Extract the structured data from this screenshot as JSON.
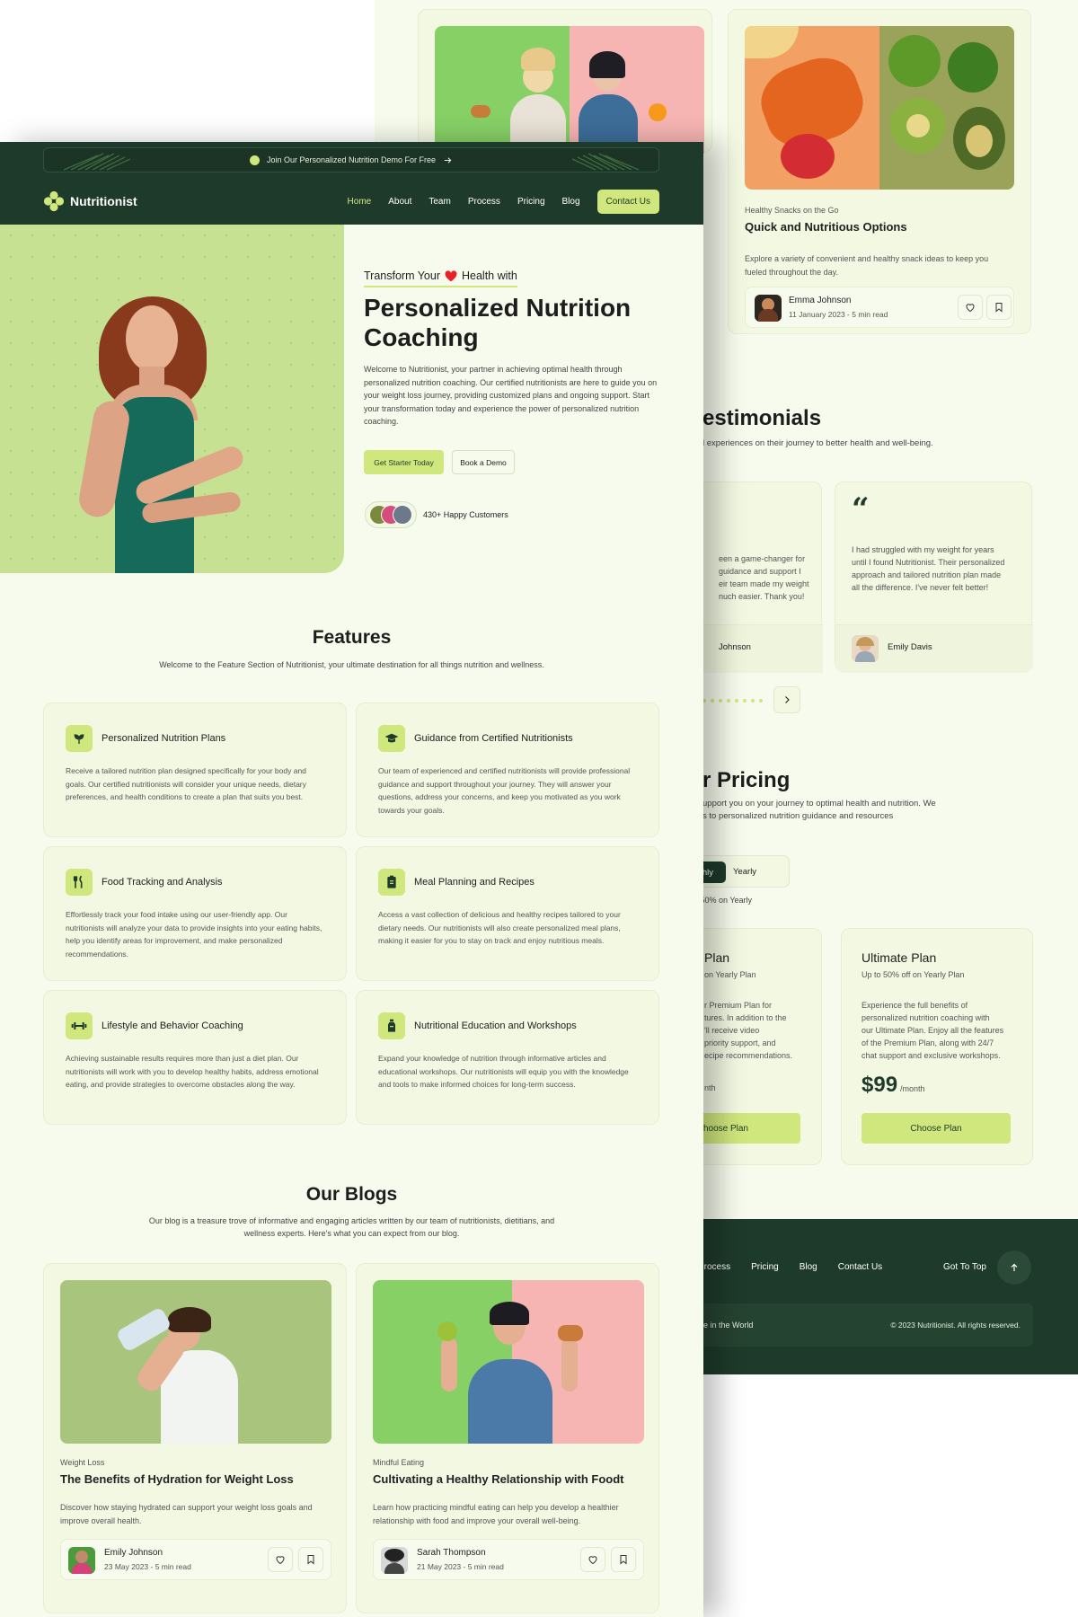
{
  "colors": {
    "dark": "#1e3a2b",
    "accent": "#cfe77c",
    "bg": "#f7fbed",
    "heart": "#e8202a"
  },
  "back": {
    "blog": {
      "category": "Healthy Snacks on the Go",
      "title": "Quick and Nutritious Options",
      "desc": "Explore a variety of convenient and healthy snack ideas to keep you fueled throughout the day.",
      "author": "Emma Johnson",
      "meta": "11 January 2023 - 5 min read"
    },
    "testimonials": {
      "title": "estimonials",
      "sub": "l experiences on their journey to better health and well-being.",
      "t1_lines": [
        "een a game-changer for",
        "guidance and support I",
        "eir team made my weight",
        "nuch easier. Thank you!"
      ],
      "t1_name": "Johnson",
      "quote_mark": "“",
      "t2_lines": [
        "I had struggled with my weight for years",
        "until I found Nutritionist. Their personalized",
        "approach and tailored nutrition plan made",
        "all the difference. I've never felt better!"
      ],
      "t2_name": "Emily Davis"
    },
    "pricing": {
      "title": "r Pricing",
      "sub_lines": [
        "upport you on your journey to optimal health and nutrition. We",
        "s to personalized nutrition guidance and resources"
      ],
      "toggle_active": "hly",
      "toggle_other": "Yearly",
      "save": "e 50% on Yearly",
      "plan1_name": "Plan",
      "plan1_sub": "on Yearly Plan",
      "plan1_lines": [
        "r Premium Plan for",
        "tures. In addition to the",
        "'ll receive video",
        "priority support, and",
        "ecipe recommendations."
      ],
      "plan1_price_tail": "nth",
      "plan1_btn": "hoose Plan",
      "plan2_name": "Ultimate Plan",
      "plan2_sub": "Up to 50% off on Yearly Plan",
      "plan2_lines": [
        "Experience the full benefits of",
        "personalized nutrition coaching with",
        "our Ultimate Plan. Enjoy all the features",
        "of the Premium Plan, along with 24/7",
        "chat support and exclusive workshops."
      ],
      "plan2_price": "$99",
      "plan2_per": "/month",
      "plan2_btn": "Choose Plan"
    },
    "footer": {
      "links": [
        "Process",
        "Pricing",
        "Blog",
        "Contact Us"
      ],
      "go_top": "Got To Top",
      "left_text": "re in the World",
      "copyright": "© 2023 Nutritionist. All rights reserved."
    }
  },
  "front": {
    "banner": "Join Our Personalized Nutrition Demo For Free",
    "brand": "Nutritionist",
    "nav": [
      "Home",
      "About",
      "Team",
      "Process",
      "Pricing",
      "Blog"
    ],
    "contact": "Contact Us",
    "hero": {
      "tag_pre": "Transform Your",
      "tag_post": "Health with",
      "title_l1": "Personalized Nutrition",
      "title_l2": "Coaching",
      "desc": "Welcome to Nutritionist, your partner in achieving optimal health through personalized nutrition coaching. Our certified nutritionists are here to guide you on your weight loss journey, providing customized plans and ongoing support. Start your transformation today and experience the power of personalized nutrition coaching.",
      "btn_primary": "Get Starter Today",
      "btn_secondary": "Book a Demo",
      "customers": "430+ Happy Customers"
    },
    "features": {
      "title": "Features",
      "sub": "Welcome to the Feature Section of Nutritionist, your ultimate destination for all things nutrition and wellness.",
      "items": [
        {
          "icon": "sprout-icon",
          "title": "Personalized Nutrition Plans",
          "desc": "Receive a tailored nutrition plan designed specifically for your body and goals. Our certified nutritionists will consider your unique needs, dietary preferences, and health conditions to create a plan that suits you best."
        },
        {
          "icon": "graduation-cap-icon",
          "title": "Guidance from Certified Nutritionists",
          "desc": "Our team of experienced and certified nutritionists will provide professional guidance and support throughout your journey. They will answer your questions, address your concerns, and keep you motivated as you work towards your goals."
        },
        {
          "icon": "fork-knife-icon",
          "title": "Food Tracking and Analysis",
          "desc": "Effortlessly track your food intake using our user-friendly app. Our nutritionists will analyze your data to provide insights into your eating habits, help you identify areas for improvement, and make personalized recommendations."
        },
        {
          "icon": "clipboard-icon",
          "title": "Meal Planning and Recipes",
          "desc": "Access a vast collection of delicious and healthy recipes tailored to your dietary needs. Our nutritionists will also create personalized meal plans, making it easier for you to stay on track and enjoy nutritious meals."
        },
        {
          "icon": "dumbbell-icon",
          "title": "Lifestyle and Behavior Coaching",
          "desc": "Achieving sustainable results requires more than just a diet plan. Our nutritionists will work with you to develop healthy habits, address emotional eating, and provide strategies to overcome obstacles along the way."
        },
        {
          "icon": "bottle-icon",
          "title": "Nutritional Education and Workshops",
          "desc": "Expand your knowledge of nutrition through informative articles and educational workshops. Our nutritionists will equip you with the knowledge and tools to make informed choices for long-term success."
        }
      ]
    },
    "blogs": {
      "title": "Our Blogs",
      "sub_l1": "Our blog is a treasure trove of informative and engaging articles written by our team of nutritionists, dietitians, and",
      "sub_l2": "wellness experts. Here's what you can expect from our blog.",
      "items": [
        {
          "category": "Weight Loss",
          "title": "The Benefits of Hydration for Weight Loss",
          "desc": "Discover how staying hydrated can support your weight loss goals and improve overall health.",
          "author": "Emily Johnson",
          "meta": "23 May 2023 - 5 min read"
        },
        {
          "category": "Mindful Eating",
          "title": "Cultivating a Healthy Relationship with Foodt",
          "desc": "Learn how practicing mindful eating can help you develop a healthier relationship with food and improve your overall well-being.",
          "author": "Sarah Thompson",
          "meta": "21 May 2023 - 5 min read"
        }
      ]
    }
  }
}
